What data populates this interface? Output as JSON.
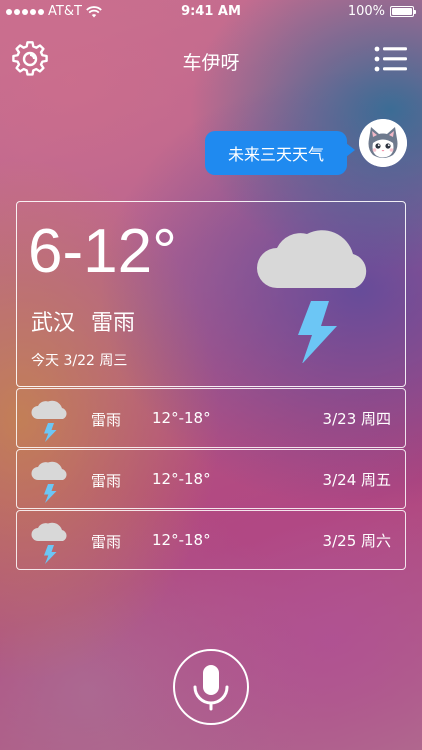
{
  "status_bar": {
    "carrier": "AT&T",
    "time": "9:41 AM",
    "battery": "100%"
  },
  "nav": {
    "title": "车伊呀",
    "settings_icon": "settings-gear-icon",
    "menu_icon": "list-menu-icon"
  },
  "chat": {
    "message": "未来三天天气",
    "avatar_icon": "cat-avatar-icon"
  },
  "today": {
    "temp_range": "6-12°",
    "city": "武汉",
    "condition": "雷雨",
    "date": "今天 3/22 周三",
    "icon": "thunderstorm-icon"
  },
  "forecast": [
    {
      "condition": "雷雨",
      "temp": "12°-18°",
      "date": "3/23 周四",
      "icon": "thunderstorm-icon"
    },
    {
      "condition": "雷雨",
      "temp": "12°-18°",
      "date": "3/24 周五",
      "icon": "thunderstorm-icon"
    },
    {
      "condition": "雷雨",
      "temp": "12°-18°",
      "date": "3/25 周六",
      "icon": "thunderstorm-icon"
    }
  ],
  "mic_icon": "microphone-icon",
  "colors": {
    "bubble": "#1f8af0",
    "cloud": "#d8d8d8",
    "bolt": "#6cc6f5"
  }
}
